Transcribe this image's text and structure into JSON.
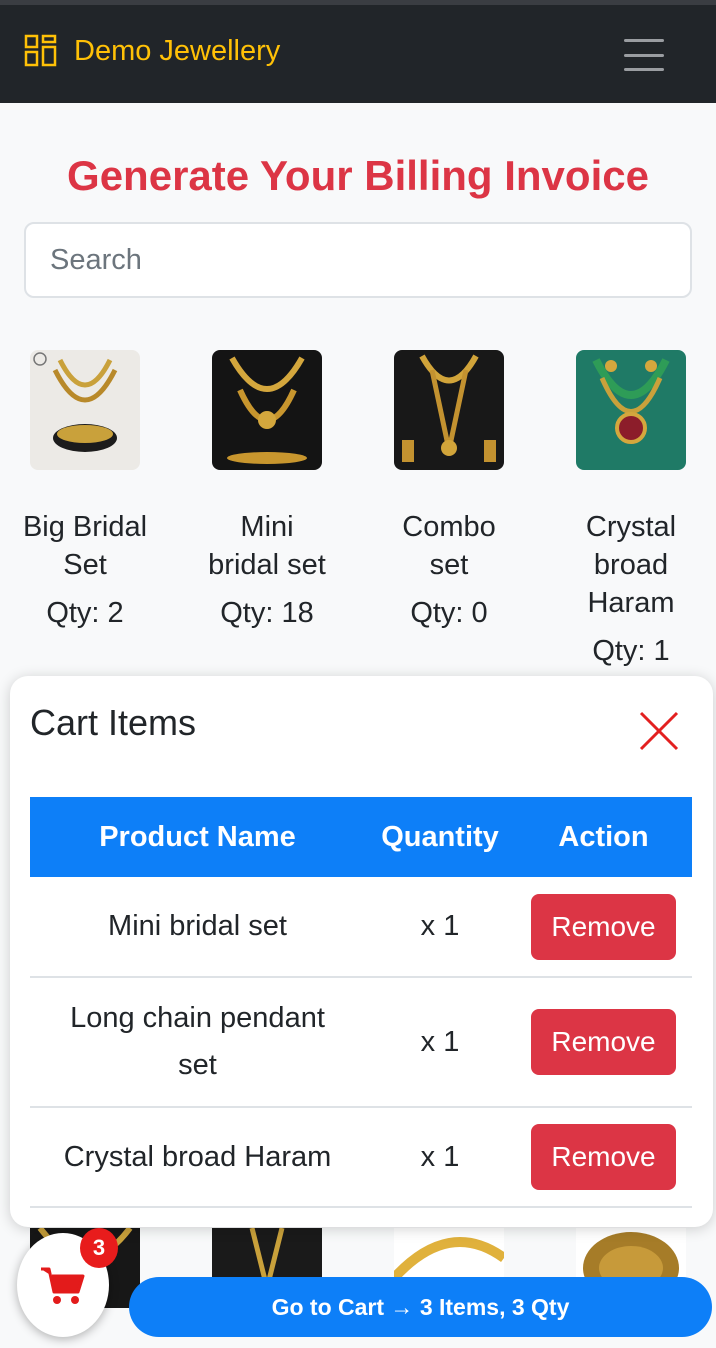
{
  "navbar": {
    "brand": "Demo Jewellery",
    "brand_icon": "grid-icon",
    "menu_icon": "hamburger-icon",
    "brand_color": "#ffc107"
  },
  "page": {
    "title": "Generate Your Billing Invoice",
    "search_placeholder": "Search"
  },
  "products": [
    {
      "name": "Big Bridal Set",
      "qty": "Qty: 2"
    },
    {
      "name": "Mini bridal set",
      "qty": "Qty: 18"
    },
    {
      "name": "Combo set",
      "qty": "Qty: 0"
    },
    {
      "name": "Crystal broad Haram",
      "qty": "Qty: 1"
    }
  ],
  "cart": {
    "title": "Cart Items",
    "close_icon": "close-icon",
    "headers": {
      "name": "Product Name",
      "quantity": "Quantity",
      "action": "Action"
    },
    "items": [
      {
        "name": "Mini bridal set",
        "qty": "x 1",
        "action": "Remove"
      },
      {
        "name": "Long chain pendant set",
        "qty": "x 1",
        "action": "Remove"
      },
      {
        "name": "Crystal broad Haram",
        "qty": "x 1",
        "action": "Remove"
      }
    ]
  },
  "footer": {
    "cart_icon": "shopping-cart-icon",
    "badge": "3",
    "goto_cart": "Go to Cart → 3 Items, 3 Qty"
  },
  "colors": {
    "navbar_bg": "#212529",
    "accent_red": "#dc3545",
    "primary_blue": "#0d7ff8",
    "badge_red": "#e81c1c"
  }
}
